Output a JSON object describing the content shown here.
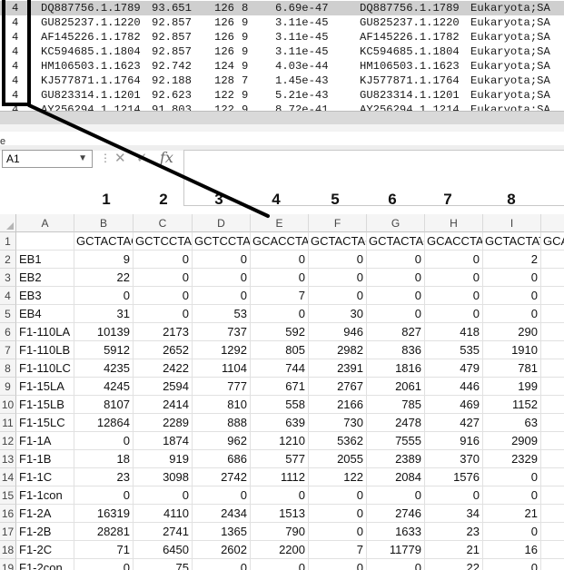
{
  "terminal": {
    "lines": [
      {
        "n": "4",
        "acc": "DQ887756.1.1789",
        "pid": "93.651",
        "len": "126",
        "mm": "8",
        "ev": "6.69e-47",
        "acc2": "DQ887756.1.1789",
        "tax": "Eukaryota;SA",
        "selected": true
      },
      {
        "n": "4",
        "acc": "GU825237.1.1220",
        "pid": "92.857",
        "len": "126",
        "mm": "9",
        "ev": "3.11e-45",
        "acc2": "GU825237.1.1220",
        "tax": "Eukaryota;SA",
        "selected": false
      },
      {
        "n": "4",
        "acc": "AF145226.1.1782",
        "pid": "92.857",
        "len": "126",
        "mm": "9",
        "ev": "3.11e-45",
        "acc2": "AF145226.1.1782",
        "tax": "Eukaryota;SA",
        "selected": false
      },
      {
        "n": "4",
        "acc": "KC594685.1.1804",
        "pid": "92.857",
        "len": "126",
        "mm": "9",
        "ev": "3.11e-45",
        "acc2": "KC594685.1.1804",
        "tax": "Eukaryota;SA",
        "selected": false
      },
      {
        "n": "4",
        "acc": "HM106503.1.1623",
        "pid": "92.742",
        "len": "124",
        "mm": "9",
        "ev": "4.03e-44",
        "acc2": "HM106503.1.1623",
        "tax": "Eukaryota;SA",
        "selected": false
      },
      {
        "n": "4",
        "acc": "KJ577871.1.1764",
        "pid": "92.188",
        "len": "128",
        "mm": "7",
        "ev": "1.45e-43",
        "acc2": "KJ577871.1.1764",
        "tax": "Eukaryota;SA",
        "selected": false
      },
      {
        "n": "4",
        "acc": "GU823314.1.1201",
        "pid": "92.623",
        "len": "122",
        "mm": "9",
        "ev": "5.21e-43",
        "acc2": "GU823314.1.1201",
        "tax": "Eukaryota;SA",
        "selected": false
      },
      {
        "n": "4",
        "acc": "AY256294.1.1214",
        "pid": "91.803",
        "len": "122",
        "mm": "9",
        "ev": "8.72e-41",
        "acc2": "AY256294.1.1214",
        "tax": "Eukaryota;SA",
        "selected": false
      }
    ]
  },
  "pane_fragment": "e",
  "formula_bar": {
    "name_box": "A1",
    "chevron_icon": "chevron-down-icon",
    "dots": "⋮",
    "cancel_glyph": "✕",
    "enter_glyph": "✓",
    "fx_label": "fx",
    "formula": ""
  },
  "annotations": [
    "1",
    "2",
    "3",
    "4",
    "5",
    "6",
    "7",
    "8"
  ],
  "grid": {
    "columns": [
      "A",
      "B",
      "C",
      "D",
      "E",
      "F",
      "G",
      "H",
      "I"
    ],
    "header_row": [
      "",
      "GCTACTAC",
      "GCTCCTAC",
      "GCTCCTAC",
      "GCACCTAC",
      "GCTACTAC",
      "GCTACTAC",
      "GCACCTAC",
      "GCTACTAT",
      "GCA"
    ],
    "rows": [
      {
        "n": "2",
        "label": "EB1",
        "vals": [
          "9",
          "0",
          "0",
          "0",
          "0",
          "0",
          "0",
          "2"
        ]
      },
      {
        "n": "3",
        "label": "EB2",
        "vals": [
          "22",
          "0",
          "0",
          "0",
          "0",
          "0",
          "0",
          "0"
        ]
      },
      {
        "n": "4",
        "label": "EB3",
        "vals": [
          "0",
          "0",
          "0",
          "7",
          "0",
          "0",
          "0",
          "0"
        ]
      },
      {
        "n": "5",
        "label": "EB4",
        "vals": [
          "31",
          "0",
          "53",
          "0",
          "30",
          "0",
          "0",
          "0"
        ]
      },
      {
        "n": "6",
        "label": "F1-110LA",
        "vals": [
          "10139",
          "2173",
          "737",
          "592",
          "946",
          "827",
          "418",
          "290"
        ]
      },
      {
        "n": "7",
        "label": "F1-110LB",
        "vals": [
          "5912",
          "2652",
          "1292",
          "805",
          "2982",
          "836",
          "535",
          "1910"
        ]
      },
      {
        "n": "8",
        "label": "F1-110LC",
        "vals": [
          "4235",
          "2422",
          "1104",
          "744",
          "2391",
          "1816",
          "479",
          "781"
        ]
      },
      {
        "n": "9",
        "label": "F1-15LA",
        "vals": [
          "4245",
          "2594",
          "777",
          "671",
          "2767",
          "2061",
          "446",
          "199"
        ]
      },
      {
        "n": "10",
        "label": "F1-15LB",
        "vals": [
          "8107",
          "2414",
          "810",
          "558",
          "2166",
          "785",
          "469",
          "1152"
        ]
      },
      {
        "n": "11",
        "label": "F1-15LC",
        "vals": [
          "12864",
          "2289",
          "888",
          "639",
          "730",
          "2478",
          "427",
          "63"
        ]
      },
      {
        "n": "12",
        "label": "F1-1A",
        "vals": [
          "0",
          "1874",
          "962",
          "1210",
          "5362",
          "7555",
          "916",
          "2909"
        ]
      },
      {
        "n": "13",
        "label": "F1-1B",
        "vals": [
          "18",
          "919",
          "686",
          "577",
          "2055",
          "2389",
          "370",
          "2329"
        ]
      },
      {
        "n": "14",
        "label": "F1-1C",
        "vals": [
          "23",
          "3098",
          "2742",
          "1112",
          "122",
          "2084",
          "1576",
          "0"
        ]
      },
      {
        "n": "15",
        "label": "F1-1con",
        "vals": [
          "0",
          "0",
          "0",
          "0",
          "0",
          "0",
          "0",
          "0"
        ]
      },
      {
        "n": "16",
        "label": "F1-2A",
        "vals": [
          "16319",
          "4110",
          "2434",
          "1513",
          "0",
          "2746",
          "34",
          "21"
        ]
      },
      {
        "n": "17",
        "label": "F1-2B",
        "vals": [
          "28281",
          "2741",
          "1365",
          "790",
          "0",
          "1633",
          "23",
          "0"
        ]
      },
      {
        "n": "18",
        "label": "F1-2C",
        "vals": [
          "71",
          "6450",
          "2602",
          "2200",
          "7",
          "11779",
          "21",
          "16"
        ]
      },
      {
        "n": "19",
        "label": "F1-2con",
        "vals": [
          "0",
          "75",
          "0",
          "0",
          "0",
          "0",
          "22",
          "0"
        ]
      }
    ]
  }
}
